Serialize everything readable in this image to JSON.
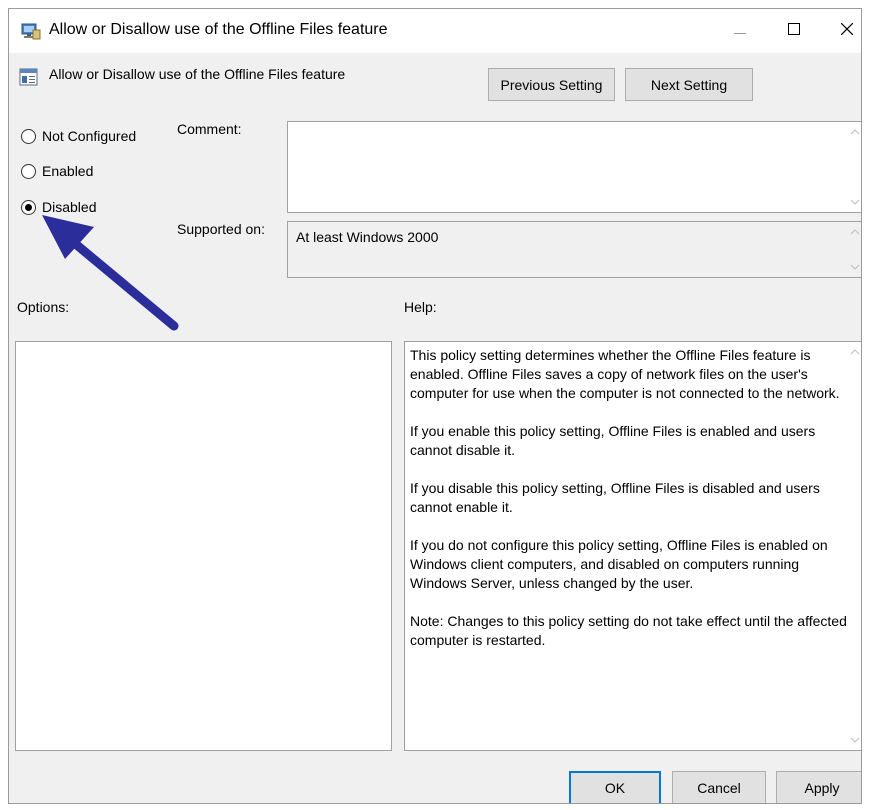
{
  "window": {
    "title": "Allow or Disallow use of the Offline Files feature",
    "controls": {
      "minimize": "—",
      "maximize": "☐",
      "close": "✕"
    }
  },
  "header": {
    "setting_name": "Allow or Disallow use of the Offline Files feature",
    "previous_label": "Previous Setting",
    "next_label": "Next Setting"
  },
  "state": {
    "options": [
      {
        "label": "Not Configured",
        "checked": false
      },
      {
        "label": "Enabled",
        "checked": false
      },
      {
        "label": "Disabled",
        "checked": true
      }
    ]
  },
  "comment": {
    "label": "Comment:",
    "value": ""
  },
  "supported": {
    "label": "Supported on:",
    "value": "At least Windows 2000"
  },
  "options_panel": {
    "label": "Options:"
  },
  "help_panel": {
    "label": "Help:",
    "paragraphs": [
      "This policy setting determines whether the Offline Files feature is enabled. Offline Files saves a copy of network files on the user's computer for use when the computer is not connected to the network.",
      "If you enable this policy setting, Offline Files is enabled and users cannot disable it.",
      "If you disable this policy setting, Offline Files is disabled and users cannot enable it.",
      "If you do not configure this policy setting, Offline Files is enabled on Windows client computers, and disabled on computers running Windows Server, unless changed by the user.",
      "Note: Changes to this policy setting do not take effect until the affected computer is restarted."
    ]
  },
  "footer": {
    "ok_label": "OK",
    "cancel_label": "Cancel",
    "apply_label": "Apply"
  },
  "colors": {
    "accent": "#0078d7",
    "annotation_arrow": "#2b2d9a",
    "dialog_bg": "#f0f0f0"
  },
  "icons": [
    "app-policy-icon",
    "policy-setting-icon",
    "scroll-up-icon",
    "scroll-down-icon",
    "annotation-arrow-icon"
  ]
}
